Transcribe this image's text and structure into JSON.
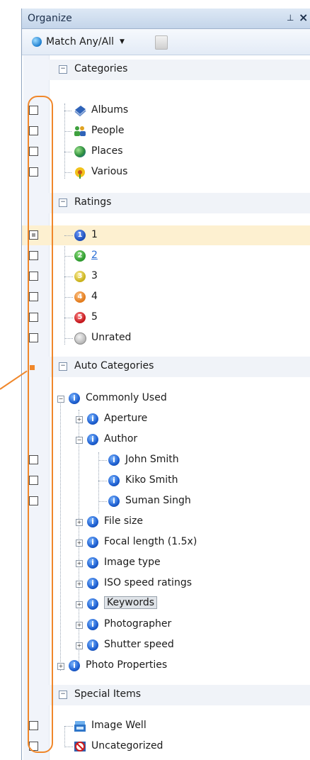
{
  "panel": {
    "title": "Organize",
    "pin_icon": "pin-icon",
    "close_icon": "close-icon"
  },
  "toolbar": {
    "match_label": "Match Any/All"
  },
  "sections": {
    "categories": {
      "title": "Categories",
      "items": [
        {
          "label": "Albums",
          "icon": "albums-icon"
        },
        {
          "label": "People",
          "icon": "people-icon"
        },
        {
          "label": "Places",
          "icon": "places-icon"
        },
        {
          "label": "Various",
          "icon": "various-icon"
        }
      ]
    },
    "ratings": {
      "title": "Ratings",
      "items": [
        {
          "label": "1",
          "badge": "1",
          "color": "#1f4fb8",
          "checkbox": "mixed",
          "highlighted": true
        },
        {
          "label": "2",
          "badge": "2",
          "color": "#2e9a2e",
          "link": true
        },
        {
          "label": "3",
          "badge": "3",
          "color": "#c9b21c"
        },
        {
          "label": "4",
          "badge": "4",
          "color": "#e27b1c"
        },
        {
          "label": "5",
          "badge": "5",
          "color": "#c4161c"
        },
        {
          "label": "Unrated",
          "color": "#b7b7b7"
        }
      ]
    },
    "auto_categories": {
      "title": "Auto Categories",
      "commonly_used": "Commonly Used",
      "aperture": "Aperture",
      "author": "Author",
      "authors": [
        "John Smith",
        "Kiko Smith",
        "Suman Singh"
      ],
      "file_size": "File size",
      "focal_length": "Focal length (1.5x)",
      "image_type": "Image type",
      "iso": "ISO speed ratings",
      "keywords": "Keywords",
      "photographer": "Photographer",
      "shutter_speed": "Shutter speed",
      "photo_properties": "Photo Properties"
    },
    "special_items": {
      "title": "Special Items",
      "items": [
        {
          "label": "Image Well",
          "icon": "image-well-icon"
        },
        {
          "label": "Uncategorized",
          "icon": "uncategorized-icon"
        }
      ]
    }
  },
  "colors": {
    "callout": "#f0872a",
    "highlight": "#fdf0d0"
  }
}
